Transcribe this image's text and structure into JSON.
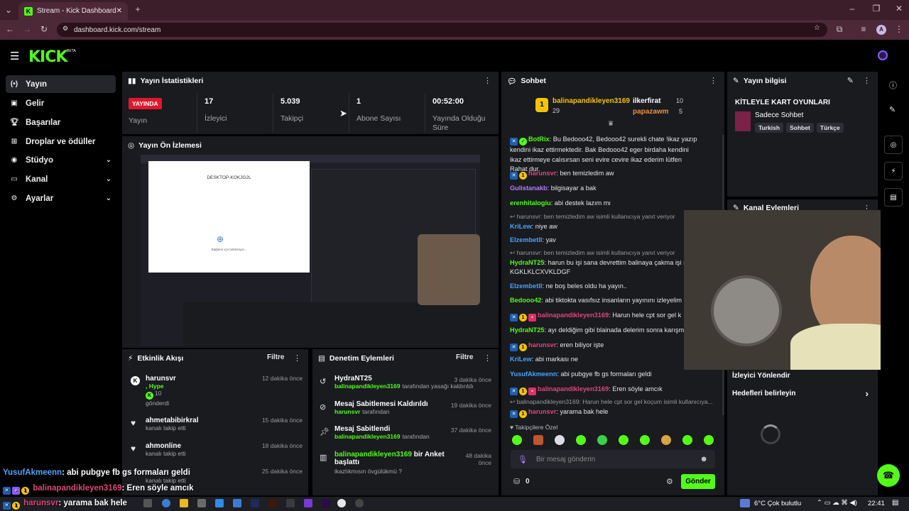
{
  "browser": {
    "tab_title": "Stream - Kick Dashboard",
    "url": "dashboard.kick.com/stream",
    "profile": "A"
  },
  "brand": {
    "logo": "KICK",
    "beta": "BETA",
    "accent": "#53fc18"
  },
  "sidebar": {
    "items": [
      {
        "label": "Yayın",
        "icon": "broadcast-icon"
      },
      {
        "label": "Gelir",
        "icon": "revenue-icon"
      },
      {
        "label": "Başarılar",
        "icon": "trophy-icon"
      },
      {
        "label": "Droplar ve ödüller",
        "icon": "gift-icon"
      },
      {
        "label": "Stüdyo",
        "icon": "studio-icon"
      },
      {
        "label": "Kanal",
        "icon": "channel-icon"
      },
      {
        "label": "Ayarlar",
        "icon": "gear-icon"
      }
    ]
  },
  "stats": {
    "title": "Yayın İstatistikleri",
    "live_badge": "YAYINDA",
    "status_label": "Yayın",
    "viewers": "17",
    "viewers_label": "İzleyici",
    "followers": "5.039",
    "followers_label": "Takipçi",
    "subs": "1",
    "subs_label": "Abone Sayısı",
    "uptime": "00:52:00",
    "uptime_label": "Yayında Olduğu Süre"
  },
  "preview": {
    "title": "Yayın Ön İzlemesi",
    "window_title": "DESKTOP-KOKJG2L",
    "overlay_text": "Bağlantı için bekleniyor..."
  },
  "events": {
    "title": "Etkinlik Akışı",
    "filter": "Filtre",
    "rows": [
      {
        "name": "harunsvr",
        "line1": ", Hype",
        "line2": "10",
        "line3": "gönderdi",
        "time": "12 dakika önce"
      },
      {
        "name": "ahmetabibirkral",
        "line1": "kanalı takip etti",
        "time": "15 dakika önce"
      },
      {
        "name": "ahmonline",
        "line1": "kanalı takip etti",
        "time": "18 dakika önce"
      },
      {
        "name": "kanalı takip etti",
        "time": "25 dakika önce"
      }
    ]
  },
  "moderation": {
    "title": "Denetim Eylemleri",
    "filter": "Filtre",
    "rows": [
      {
        "title": "HydraNT25",
        "by": "balinapandikleyen3169",
        "action": "tarafından yasağı kaldırıldı",
        "time": "3 dakika önce"
      },
      {
        "title": "Mesaj Sabitlemesi Kaldırıldı",
        "by": "harunsvr",
        "action": "tarafından",
        "time": "19 dakika önce"
      },
      {
        "title": "Mesaj Sabitlendi",
        "by": "balinapandikleyen3169",
        "action": "tarafından",
        "time": "37 dakika önce"
      },
      {
        "title": "balinapandikleyen3169",
        "title2": "bir Anket başlattı",
        "action": "ikazlıkmısın övgülükmü ?",
        "time": "48 dakika önce"
      }
    ]
  },
  "chat": {
    "title": "Sohbet",
    "top": [
      {
        "rank": "1",
        "name": "balinapandikleyen3169",
        "count": "29"
      },
      {
        "name": "ilkerfirat",
        "count": "10"
      },
      {
        "name": "papazawm",
        "count": "5"
      }
    ],
    "messages": [
      {
        "user": "BotRix",
        "color": "#53fc18",
        "text": "Bu Bedooo42, Bedooo42 surekli chate !ikaz yazıp kendini ikaz ettirmektedir. Bak Bedooo42 eger birdaha kendini ikaz ettirmeye calısırsan seni evire cevire ikaz ederim lütfen Rahat dur."
      },
      {
        "user": "harunsvr",
        "color": "#e0457b",
        "text": "ben temizledim aw"
      },
      {
        "user": "Gulistanakb",
        "color": "#b57cff",
        "text": "bilgisayar a bak"
      },
      {
        "user": "erenhitalogiu",
        "color": "#53fc18",
        "text": "abi destek lazım mı"
      },
      {
        "reply": "harunsvr: ben temizledim aw isimli kullanıcıya yanıt veriyor",
        "user": "KriLew",
        "color": "#4aa3ff",
        "text": "niye aw"
      },
      {
        "user": "Elzembetll",
        "color": "#4aa3ff",
        "text": "yav"
      },
      {
        "reply": "harunsvr: ben temizledim aw isimli kullanıcıya yanıt veriyor",
        "user": "HydraNT25",
        "color": "#53fc18",
        "text": "harun bu işi sana devrettim balinaya çakma işi s KGKLKLCXVKLDGF"
      },
      {
        "user": "Elzembetll",
        "color": "#4aa3ff",
        "text": "ne boş beles oldu ha yayın.."
      },
      {
        "user": "Bedooo42",
        "color": "#53fc18",
        "text": "abi tiktokta vasıfsız insanların yayınını izleyelim"
      },
      {
        "user": "balinapandikleyen3169",
        "color": "#e0457b",
        "text": "Harun hele cpt sor gel k"
      },
      {
        "user": "HydraNT25",
        "color": "#53fc18",
        "text": "ayı deldiğim gibi blainada delerim sonra karışm"
      },
      {
        "user": "harunsvr",
        "color": "#e0457b",
        "text": "eren biliyor işte"
      },
      {
        "user": "KriLew",
        "color": "#4aa3ff",
        "text": "abi markası ne"
      },
      {
        "user": "YusufAkmeenn",
        "color": "#4aa3ff",
        "text": "abi pubgye fb gs formaları geldi"
      },
      {
        "user": "balinapandikleyen3169",
        "color": "#e0457b",
        "text": "Eren söyle amcık"
      },
      {
        "reply": "balinapandikleyen3169: Harun hele cpt sor gel koçum isimli kullanıcıya...",
        "user": "harunsvr",
        "color": "#e0457b",
        "text": "yarama bak hele"
      }
    ],
    "emote_label": "Takipçilere Özel",
    "input_placeholder": "Bir mesaj gönderin",
    "points": "0",
    "send": "Gönder"
  },
  "stream_info": {
    "title": "Yayın bilgisi",
    "stream_title": "KİTLEYLE KART OYUNLARI",
    "category": "Sadece Sohbet",
    "tags": [
      "Turkish",
      "Sohbet",
      "Türkçe"
    ],
    "channel_actions": "Kanal Eylemleri",
    "viewer_goal": "İzleyici Yönlendir",
    "set_goals": "Hedefleri belirleyin"
  },
  "overlay": {
    "lines": [
      {
        "user": "YusufAkmeenn",
        "text": ": abi pubgye fb gs formaları geldi"
      },
      {
        "user": "balinapandikleyen3169",
        "text": ": Eren söyle amcık"
      },
      {
        "user": "harunsvr",
        "text": ": yarama bak hele"
      }
    ]
  },
  "taskbar": {
    "weather": "6°C  Çok bulutlu",
    "time": "22:41"
  }
}
